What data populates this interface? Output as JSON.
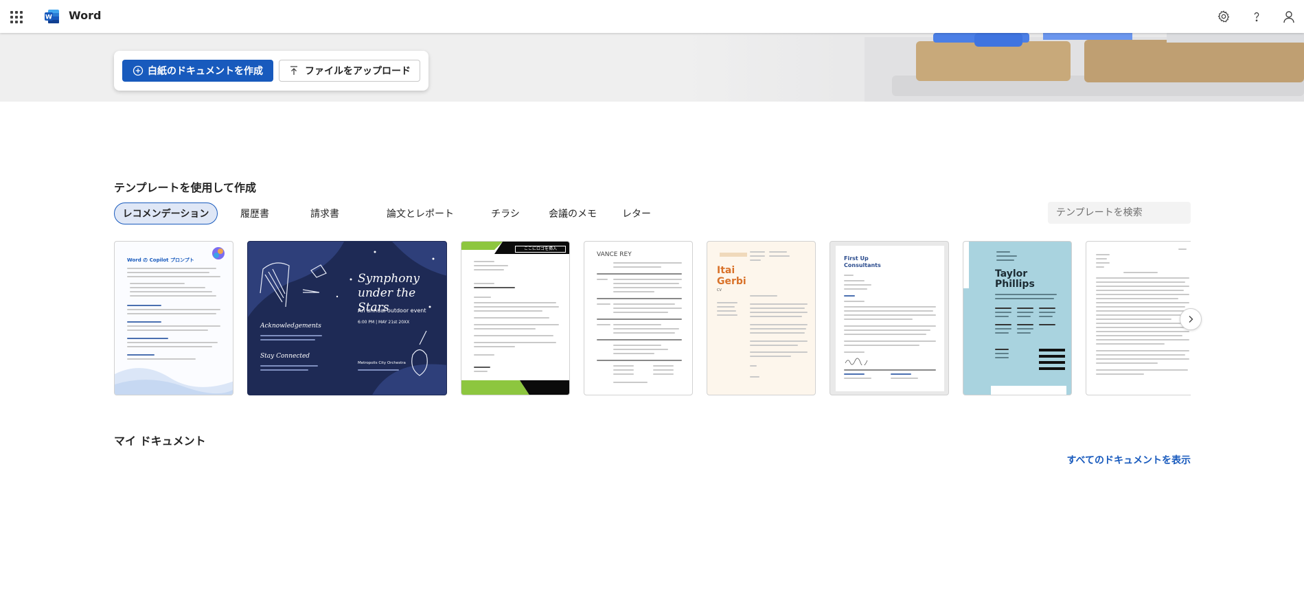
{
  "app": {
    "name": "Word",
    "brand_color": "#185abd"
  },
  "header": {
    "icons": [
      "app-launcher-icon",
      "word-logo-icon",
      "settings-icon",
      "help-icon",
      "account-icon"
    ]
  },
  "actions": {
    "new_blank": "白紙のドキュメントを作成",
    "upload": "ファイルをアップロード"
  },
  "templates": {
    "title": "テンプレートを使用して作成",
    "tabs": [
      "レコメンデーション",
      "履歴書",
      "請求書",
      "論文とレポート",
      "チラシ",
      "会議のメモ",
      "レター"
    ],
    "active_tab": "レコメンデーション",
    "search_placeholder": "テンプレートを検索",
    "cards": [
      {
        "title": "Word の Copilot プロンプト"
      },
      {
        "title": "Symphony under the Stars",
        "subtitle": "An annual outdoor event",
        "date": "6:00 PM | MAY 21st 20XX",
        "ack": "Acknowledgements",
        "stay": "Stay Connected",
        "org": "Metropolis City Orchestra"
      },
      {
        "title": "ここにロゴを挿入"
      },
      {
        "title": "VANCE REY"
      },
      {
        "title": "Itai Gerbi",
        "subtitle": "CV"
      },
      {
        "title": "First Up Consultants"
      },
      {
        "title": "Taylor Phillips"
      },
      {
        "title": ""
      }
    ]
  },
  "my_documents": {
    "title": "マイ ドキュメント",
    "show_all": "すべてのドキュメントを表示"
  }
}
